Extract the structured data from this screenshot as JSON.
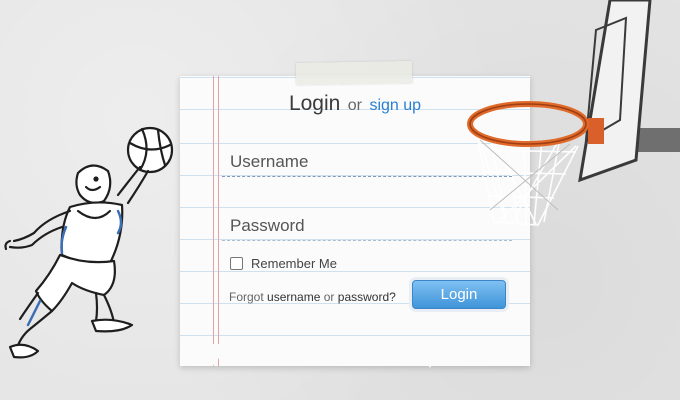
{
  "header": {
    "title": "Login",
    "or_text": "or",
    "signup_label": "sign up"
  },
  "form": {
    "username_placeholder": "Username",
    "username_value": "",
    "password_placeholder": "Password",
    "password_value": "",
    "remember_label": "Remember Me",
    "remember_checked": false,
    "forgot_prefix": "Forgot",
    "forgot_username": "username",
    "forgot_or": "or",
    "forgot_password": "password?",
    "login_button": "Login"
  },
  "colors": {
    "link": "#2a7fd4",
    "button": "#3f94d9",
    "rim": "#e06a2a"
  },
  "icons": [
    "basketball-player-icon",
    "basketball-hoop-icon",
    "tape-icon"
  ]
}
